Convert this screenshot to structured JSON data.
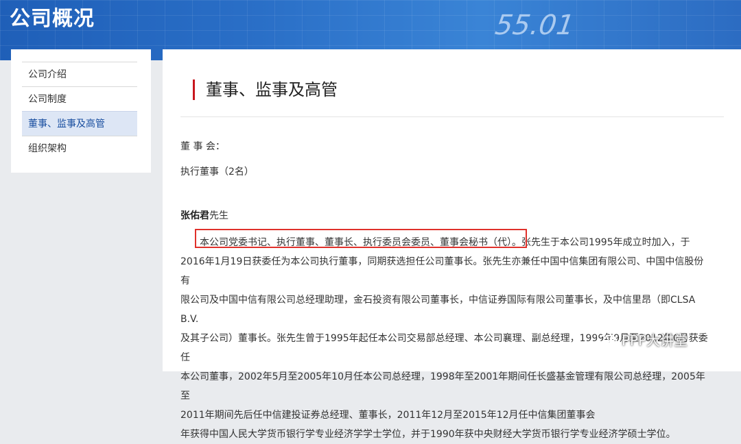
{
  "banner": {
    "title": "公司概况",
    "decor_number": "55.01"
  },
  "sidebar": {
    "items": [
      {
        "label": "公司介绍",
        "active": false
      },
      {
        "label": "公司制度",
        "active": false
      },
      {
        "label": "董事、监事及高管",
        "active": true
      },
      {
        "label": "组织架构",
        "active": false
      }
    ]
  },
  "main": {
    "title": "董事、监事及高管",
    "section_label": "董 事 会：",
    "subsection_label": "执行董事（2名）",
    "person": {
      "name": "张佑君",
      "title_suffix": "先生",
      "bio_lines": [
        "本公司党委书记、执行董事、董事长、执行委员会委员、董事会秘书（代）。张先生于本公司1995年成立时加入，于",
        "2016年1月19日获委任为本公司执行董事，同期获选担任公司董事长。张先生亦兼任中国中信集团有限公司、中国中信股份有",
        "限公司及中国中信有限公司总经理助理，金石投资有限公司董事长，中信证券国际有限公司董事长，及中信里昂（即CLSA B.V.",
        "及其子公司）董事长。张先生曾于1995年起任本公司交易部总经理、本公司襄理、副总经理，1999年9月至2012年6月获委任",
        "本公司董事，2002年5月至2005年10月任本公司总经理，1998年至2001年期间任长盛基金管理有限公司总经理，2005年至",
        "2011年期间先后任中信建投证券总经理、董事长，2011年12月至2015年12月任中信集团董事会",
        "年获得中国人民大学货币银行学专业经济学学士学位，并于1990年获中央财经大学货币银行学专业经济学硕士学位。"
      ]
    }
  },
  "watermark": {
    "text": "PPP大讲堂",
    "icon": "wechat-icon"
  },
  "colors": {
    "banner_blue": "#2a6fc7",
    "accent_red": "#c8161d",
    "highlight_red": "#e0302a",
    "active_item_bg": "#dde6f5"
  }
}
